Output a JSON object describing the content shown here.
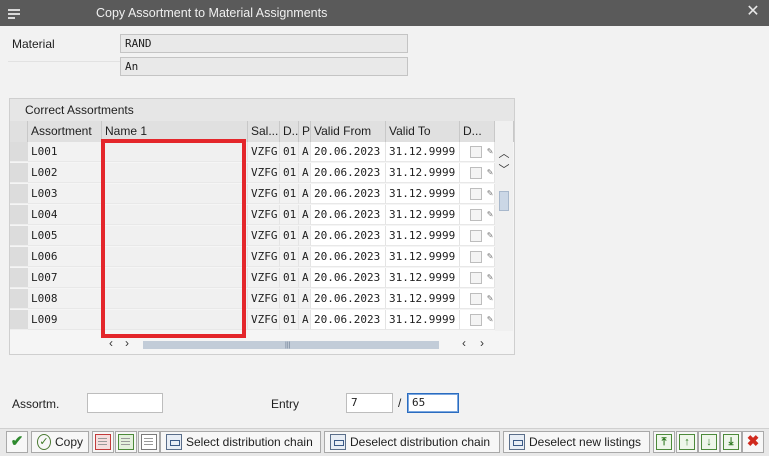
{
  "window": {
    "title": "Copy Assortment to Material Assignments",
    "close_glyph": "✕"
  },
  "header": {
    "material_label": "Material",
    "material_value": "RAND",
    "material_desc": "An"
  },
  "group": {
    "title": "Correct Assortments"
  },
  "table": {
    "columns": [
      "Assortment",
      "Name 1",
      "Sal...",
      "D..",
      "P",
      "Valid From",
      "Valid To",
      "D..."
    ],
    "rows": [
      {
        "assortment": "L001",
        "name": "",
        "sales": "VZFG",
        "d": "01",
        "p": "A",
        "valid_from": "20.06.2023",
        "valid_to": "31.12.9999"
      },
      {
        "assortment": "L002",
        "name": "",
        "sales": "VZFG",
        "d": "01",
        "p": "A",
        "valid_from": "20.06.2023",
        "valid_to": "31.12.9999"
      },
      {
        "assortment": "L003",
        "name": "",
        "sales": "VZFG",
        "d": "01",
        "p": "A",
        "valid_from": "20.06.2023",
        "valid_to": "31.12.9999"
      },
      {
        "assortment": "L004",
        "name": "",
        "sales": "VZFG",
        "d": "01",
        "p": "A",
        "valid_from": "20.06.2023",
        "valid_to": "31.12.9999"
      },
      {
        "assortment": "L005",
        "name": "",
        "sales": "VZFG",
        "d": "01",
        "p": "A",
        "valid_from": "20.06.2023",
        "valid_to": "31.12.9999"
      },
      {
        "assortment": "L006",
        "name": "",
        "sales": "VZFG",
        "d": "01",
        "p": "A",
        "valid_from": "20.06.2023",
        "valid_to": "31.12.9999"
      },
      {
        "assortment": "L007",
        "name": "",
        "sales": "VZFG",
        "d": "01",
        "p": "A",
        "valid_from": "20.06.2023",
        "valid_to": "31.12.9999"
      },
      {
        "assortment": "L008",
        "name": "",
        "sales": "VZFG",
        "d": "01",
        "p": "A",
        "valid_from": "20.06.2023",
        "valid_to": "31.12.9999"
      },
      {
        "assortment": "L009",
        "name": "",
        "sales": "VZFG",
        "d": "01",
        "p": "A",
        "valid_from": "20.06.2023",
        "valid_to": "31.12.9999"
      }
    ]
  },
  "footer": {
    "assortm_label": "Assortm.",
    "assortm_value": "",
    "entry_label": "Entry",
    "entry_value": "7",
    "entry_sep": "/",
    "entry_total": "65"
  },
  "toolbar": {
    "copy_label": "Copy",
    "select_chain_label": "Select distribution chain",
    "deselect_chain_label": "Deselect distribution chain",
    "deselect_listings_label": "Deselect new listings"
  },
  "colors": {
    "highlight_box": "#e4262b",
    "titlebar": "#5a5a5a"
  }
}
